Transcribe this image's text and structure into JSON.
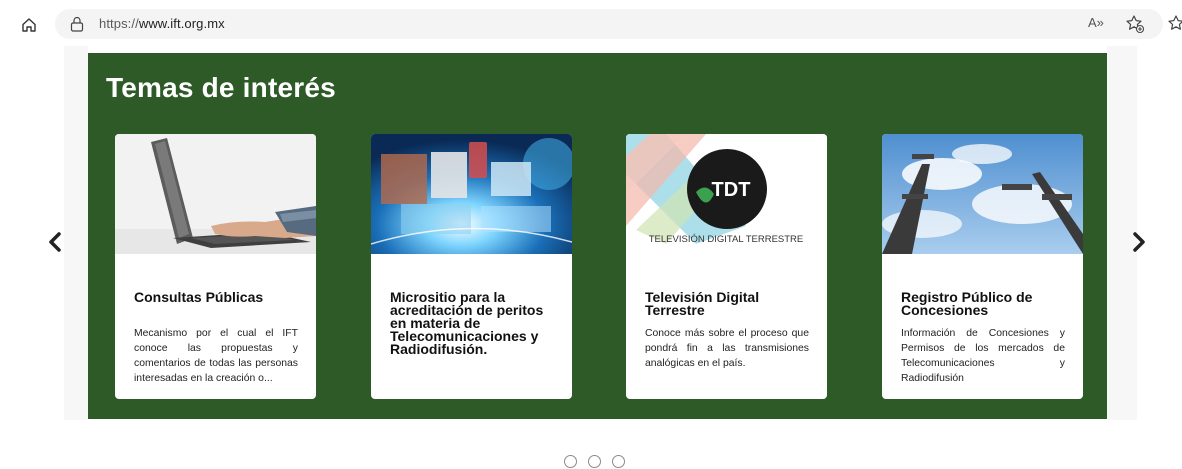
{
  "browser": {
    "url_protocol": "https://",
    "url_host": "www.ift.org.mx",
    "read_aloud_label": "A»"
  },
  "banner": {
    "title": "Temas de interés"
  },
  "cards": [
    {
      "title": "Consultas Públicas",
      "description": "Mecanismo por el cual el IFT conoce las propuestas y comentarios de todas las personas interesadas en la creación o..."
    },
    {
      "title": "Micrositio para la acreditación de peritos en materia de Telecomunicaciones y Radiodifusión.",
      "description": ""
    },
    {
      "title": "Televisión Digital Terrestre",
      "description": "Conoce más sobre el proceso que pondrá fin a las transmisiones analógicas en el país.",
      "image_logo_text": "TDT",
      "image_caption": "TELEVISIÓN DIGITAL TERRESTRE"
    },
    {
      "title": "Registro Público de Concesiones",
      "description": "Información de Concesiones y Permisos de los mercados de Telecomunicaciones y Radiodifusión"
    }
  ],
  "carousel": {
    "prev_icon": "chevron-left-icon",
    "next_icon": "chevron-right-icon",
    "page_count": 3
  },
  "colors": {
    "banner_green": "#2d5a27",
    "card_bg": "#ffffff"
  }
}
